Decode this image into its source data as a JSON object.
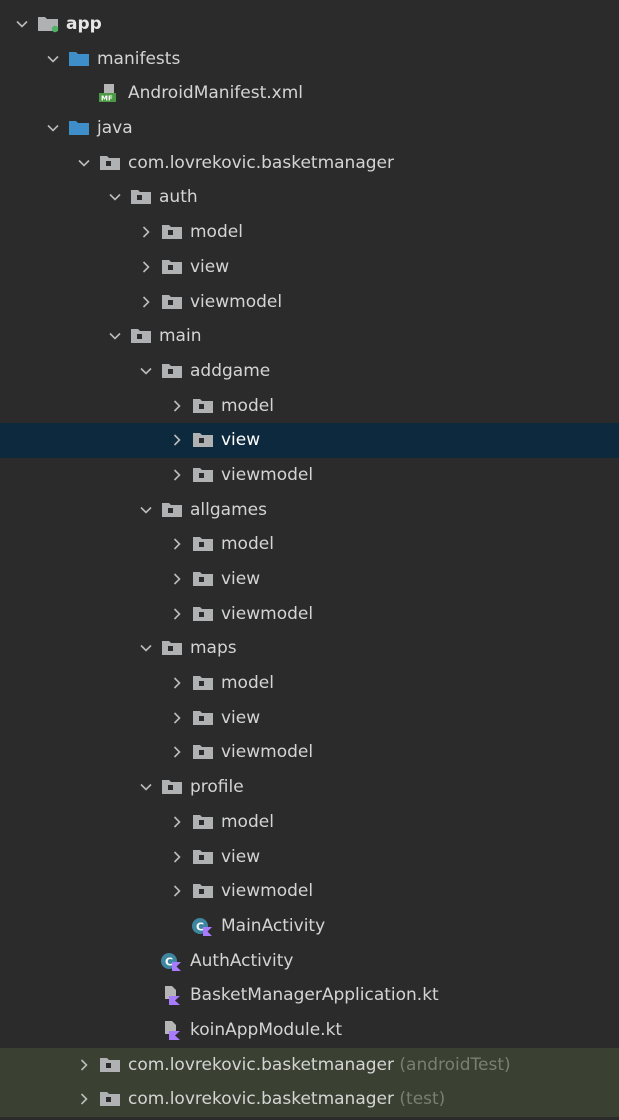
{
  "tree": {
    "rows": [
      {
        "label": "app",
        "suffix": "",
        "icon": "module-folder-icon",
        "chevron": "down"
      },
      {
        "label": "manifests",
        "suffix": "",
        "icon": "blue-folder-icon",
        "chevron": "down"
      },
      {
        "label": "AndroidManifest.xml",
        "suffix": "",
        "icon": "manifest-file-icon",
        "chevron": "none"
      },
      {
        "label": "java",
        "suffix": "",
        "icon": "blue-folder-icon",
        "chevron": "down"
      },
      {
        "label": "com.lovrekovic.basketmanager",
        "suffix": "",
        "icon": "package-folder-icon",
        "chevron": "down"
      },
      {
        "label": "auth",
        "suffix": "",
        "icon": "package-folder-icon",
        "chevron": "down"
      },
      {
        "label": "model",
        "suffix": "",
        "icon": "package-folder-icon",
        "chevron": "right"
      },
      {
        "label": "view",
        "suffix": "",
        "icon": "package-folder-icon",
        "chevron": "right"
      },
      {
        "label": "viewmodel",
        "suffix": "",
        "icon": "package-folder-icon",
        "chevron": "right"
      },
      {
        "label": "main",
        "suffix": "",
        "icon": "package-folder-icon",
        "chevron": "down"
      },
      {
        "label": "addgame",
        "suffix": "",
        "icon": "package-folder-icon",
        "chevron": "down"
      },
      {
        "label": "model",
        "suffix": "",
        "icon": "package-folder-icon",
        "chevron": "right"
      },
      {
        "label": "view",
        "suffix": "",
        "icon": "package-folder-icon",
        "chevron": "right"
      },
      {
        "label": "viewmodel",
        "suffix": "",
        "icon": "package-folder-icon",
        "chevron": "right"
      },
      {
        "label": "allgames",
        "suffix": "",
        "icon": "package-folder-icon",
        "chevron": "down"
      },
      {
        "label": "model",
        "suffix": "",
        "icon": "package-folder-icon",
        "chevron": "right"
      },
      {
        "label": "view",
        "suffix": "",
        "icon": "package-folder-icon",
        "chevron": "right"
      },
      {
        "label": "viewmodel",
        "suffix": "",
        "icon": "package-folder-icon",
        "chevron": "right"
      },
      {
        "label": "maps",
        "suffix": "",
        "icon": "package-folder-icon",
        "chevron": "down"
      },
      {
        "label": "model",
        "suffix": "",
        "icon": "package-folder-icon",
        "chevron": "right"
      },
      {
        "label": "view",
        "suffix": "",
        "icon": "package-folder-icon",
        "chevron": "right"
      },
      {
        "label": "viewmodel",
        "suffix": "",
        "icon": "package-folder-icon",
        "chevron": "right"
      },
      {
        "label": "profile",
        "suffix": "",
        "icon": "package-folder-icon",
        "chevron": "down"
      },
      {
        "label": "model",
        "suffix": "",
        "icon": "package-folder-icon",
        "chevron": "right"
      },
      {
        "label": "view",
        "suffix": "",
        "icon": "package-folder-icon",
        "chevron": "right"
      },
      {
        "label": "viewmodel",
        "suffix": "",
        "icon": "package-folder-icon",
        "chevron": "right"
      },
      {
        "label": "MainActivity",
        "suffix": "",
        "icon": "kotlin-class-icon",
        "chevron": "none"
      },
      {
        "label": "AuthActivity",
        "suffix": "",
        "icon": "kotlin-class-icon",
        "chevron": "none"
      },
      {
        "label": "BasketManagerApplication.kt",
        "suffix": "",
        "icon": "kotlin-file-icon",
        "chevron": "none"
      },
      {
        "label": "koinAppModule.kt",
        "suffix": "",
        "icon": "kotlin-file-icon",
        "chevron": "none"
      },
      {
        "label": "com.lovrekovic.basketmanager",
        "suffix": "(androidTest)",
        "icon": "package-folder-icon",
        "chevron": "right"
      },
      {
        "label": "com.lovrekovic.basketmanager",
        "suffix": "(test)",
        "icon": "package-folder-icon",
        "chevron": "right"
      }
    ]
  },
  "colors": {
    "background": "#2b2b2b",
    "selected_row": "#0d293e",
    "test_row": "#3a4132",
    "folder_blue": "#3d8ec9",
    "package_folder": "#afb1b3",
    "kotlin_purple": "#a97bff"
  }
}
